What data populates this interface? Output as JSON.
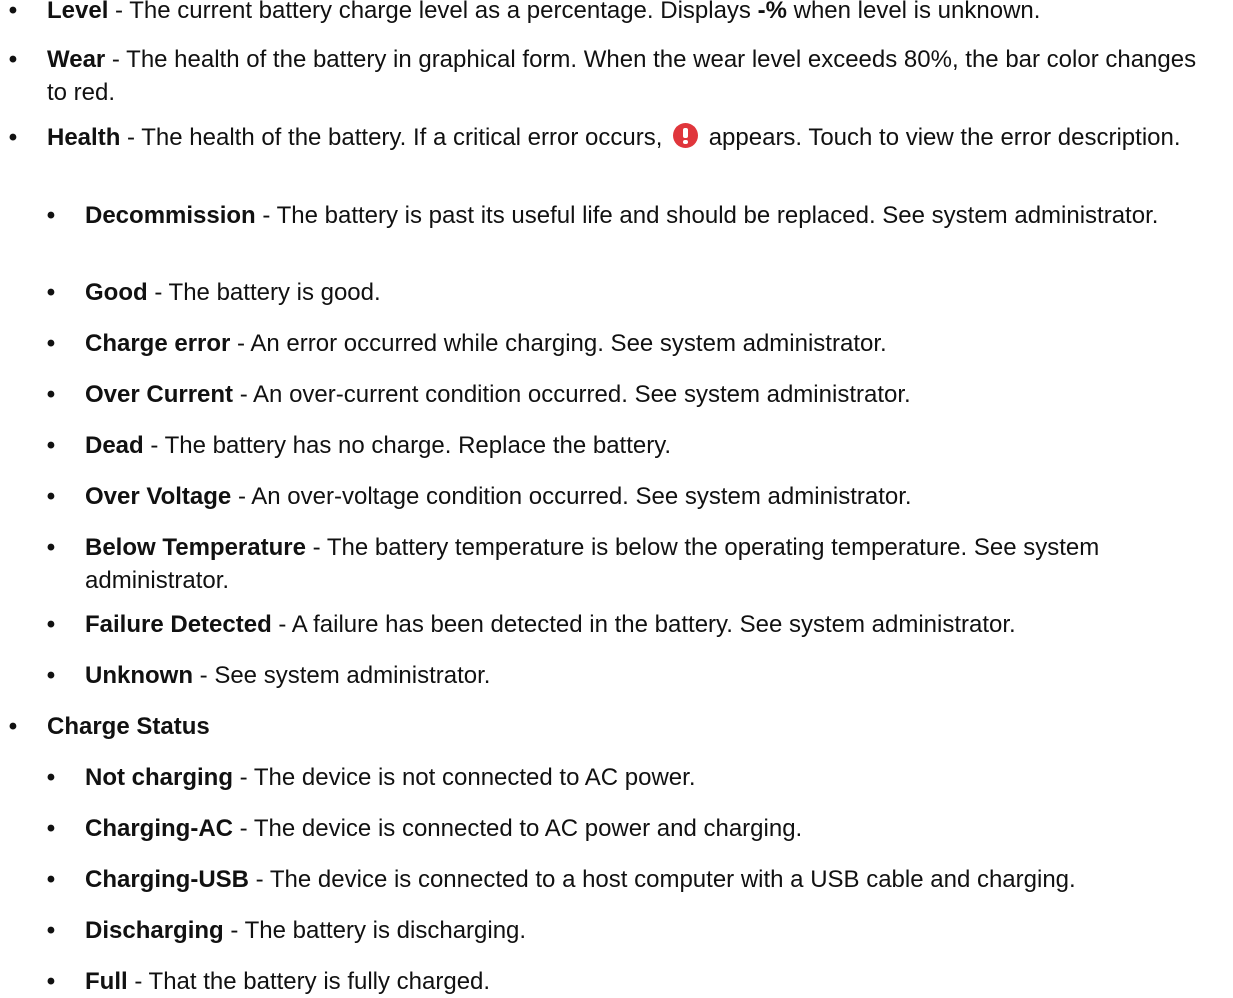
{
  "bullet": "•",
  "level": {
    "term": "Level",
    "pre": " - The current battery charge level as a percentage. Displays ",
    "value": "-%",
    "post": " when level is unknown."
  },
  "wear": {
    "term": "Wear",
    "desc": " - The health of the battery in graphical form. When the wear level exceeds 80%, the bar color changes to red."
  },
  "health": {
    "term": "Health",
    "pre": " - The health of the battery. If a critical error occurs, ",
    "icon": "error-exclamation-icon",
    "icon_color": "#e0363c",
    "post": " appears. Touch to view the error description.",
    "items": [
      {
        "term": "Decommission",
        "desc": " - The battery is past its useful life and should be replaced. See system administrator."
      },
      {
        "term": "Good",
        "desc": " - The battery is good."
      },
      {
        "term": "Charge error",
        "desc": " - An error occurred while charging. See system administrator."
      },
      {
        "term": "Over Current",
        "desc": " - An over-current condition occurred. See system administrator."
      },
      {
        "term": "Dead",
        "desc": " - The battery has no charge. Replace the battery."
      },
      {
        "term": "Over Voltage",
        "desc": " - An over-voltage condition occurred. See system administrator."
      },
      {
        "term": "Below Temperature",
        "desc": " - The battery temperature is below the operating temperature. See system administrator."
      },
      {
        "term": "Failure Detected",
        "desc": " - A failure has been detected in the battery. See system administrator."
      },
      {
        "term": "Unknown",
        "desc": " - See system administrator."
      }
    ]
  },
  "charge_status": {
    "term": "Charge Status",
    "items": [
      {
        "term": "Not charging",
        "desc": " - The device is not connected to AC power."
      },
      {
        "term": "Charging-AC",
        "desc": " - The device is connected to AC power and charging."
      },
      {
        "term": "Charging-USB",
        "desc": " - The device is connected to a host computer with a USB cable and charging."
      },
      {
        "term": "Discharging",
        "desc": " - The battery is discharging."
      },
      {
        "term": "Full",
        "desc": " - That the battery is fully charged."
      }
    ]
  }
}
